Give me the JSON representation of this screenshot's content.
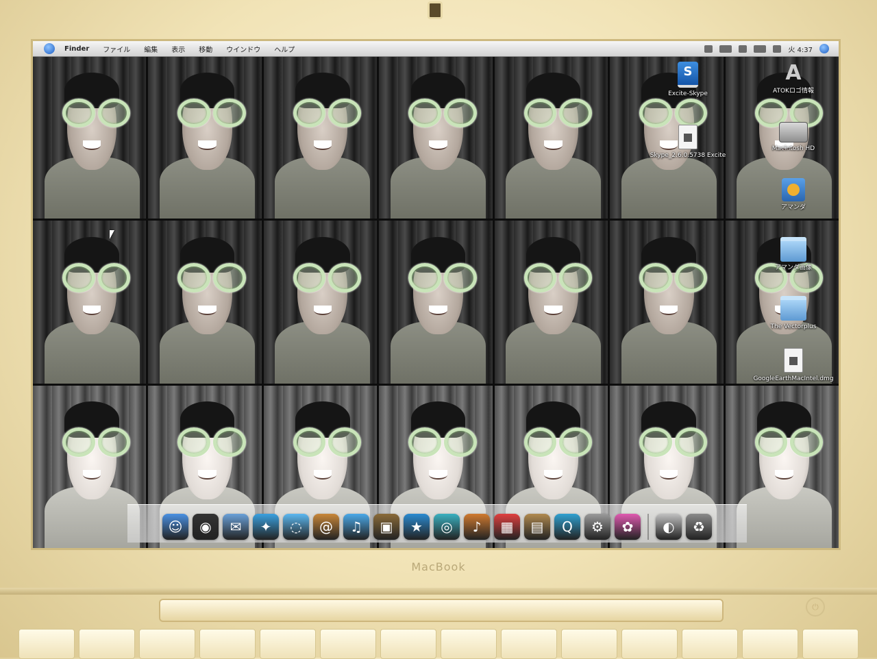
{
  "menubar": {
    "app_name": "Finder",
    "items": [
      "ファイル",
      "編集",
      "表示",
      "移動",
      "ウインドウ",
      "ヘルプ"
    ],
    "clock": "火 4:37"
  },
  "desktop_icons": [
    {
      "label": "Excite-Skype",
      "kind": "skype-icon"
    },
    {
      "label": "ATOKロゴ情報",
      "kind": "app-icon"
    },
    {
      "label": "Skype_2.6.0.5738 Excite",
      "kind": "document-icon"
    },
    {
      "label": "Macintosh HD",
      "kind": "hard-drive-icon"
    },
    {
      "label": "アマンダ",
      "kind": "app-icon"
    },
    {
      "label": "アマンダ画像",
      "kind": "folder-icon"
    },
    {
      "label": "The Vectorplus",
      "kind": "folder-icon"
    },
    {
      "label": "GoogleEarthMacIntel.dmg",
      "kind": "document-icon"
    }
  ],
  "dock_items": [
    {
      "name": "finder-icon",
      "glyph": "☺",
      "color": "#4a90e2"
    },
    {
      "name": "dashboard-icon",
      "glyph": "◉",
      "color": "#333333"
    },
    {
      "name": "mail-icon",
      "glyph": "✉",
      "color": "#6aa0d8"
    },
    {
      "name": "safari-icon",
      "glyph": "✦",
      "color": "#3aa0e0"
    },
    {
      "name": "ichat-icon",
      "glyph": "◌",
      "color": "#5bb7f0"
    },
    {
      "name": "address-book-icon",
      "glyph": "@",
      "color": "#c8873a"
    },
    {
      "name": "itunes-icon",
      "glyph": "♫",
      "color": "#4aa8e8"
    },
    {
      "name": "iphoto-icon",
      "glyph": "▣",
      "color": "#8a6b3a"
    },
    {
      "name": "imovie-icon",
      "glyph": "★",
      "color": "#2a8ad0"
    },
    {
      "name": "idvd-icon",
      "glyph": "◎",
      "color": "#3ab0c0"
    },
    {
      "name": "garageband-icon",
      "glyph": "♪",
      "color": "#d07a30"
    },
    {
      "name": "ical-icon",
      "glyph": "▦",
      "color": "#e04040"
    },
    {
      "name": "preview-icon",
      "glyph": "▤",
      "color": "#b08a50"
    },
    {
      "name": "quicktime-icon",
      "glyph": "Q",
      "color": "#30a0d0"
    },
    {
      "name": "system-preferences-icon",
      "glyph": "⚙",
      "color": "#9a9a9a"
    },
    {
      "name": "photo-booth-icon",
      "glyph": "✿",
      "color": "#e05ab0"
    },
    {
      "name": "downloads-icon",
      "glyph": "◐",
      "color": "#c0c0c0"
    },
    {
      "name": "trash-icon",
      "glyph": "♻",
      "color": "#8a8a8a"
    }
  ],
  "bottom": {
    "brand": "MacBook",
    "power_glyph": "⏻"
  }
}
